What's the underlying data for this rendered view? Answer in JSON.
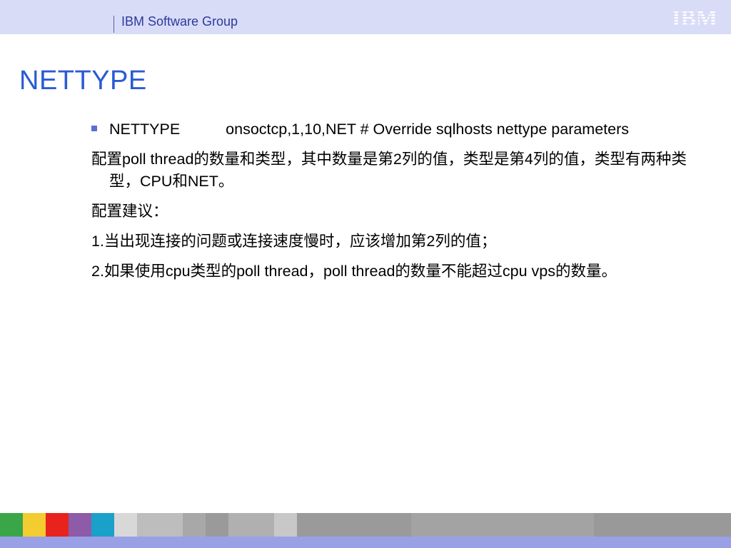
{
  "header": {
    "org": "IBM Software Group",
    "logo_text": "IBM",
    "bg_color": "#d9dcf7"
  },
  "slide": {
    "title": "NETTYPE",
    "bullet": {
      "key": "NETTYPE",
      "value": "onsoctcp,1,10,NET # Override sqlhosts nettype parameters"
    },
    "paragraphs": [
      "配置poll thread的数量和类型，其中数量是第2列的值，类型是第4列的值，类型有两种类型，CPU和NET。",
      "配置建议：",
      "1.当出现连接的问题或连接速度慢时，应该增加第2列的值；",
      "2.如果使用cpu类型的poll thread，poll thread的数量不能超过cpu vps的数量。"
    ]
  },
  "footer": {
    "colors": [
      "#3aa648",
      "#f2cc30",
      "#e8231d",
      "#8d5ba8",
      "#1aa1c9",
      "#d8d8d8",
      "#bdbdbd",
      "#a8a8a8",
      "#9a9a9a",
      "#b0b0b0",
      "#c8c8c8",
      "#9a9a9a",
      "#9a9a9a",
      "#a3a3a3",
      "#999999"
    ]
  }
}
